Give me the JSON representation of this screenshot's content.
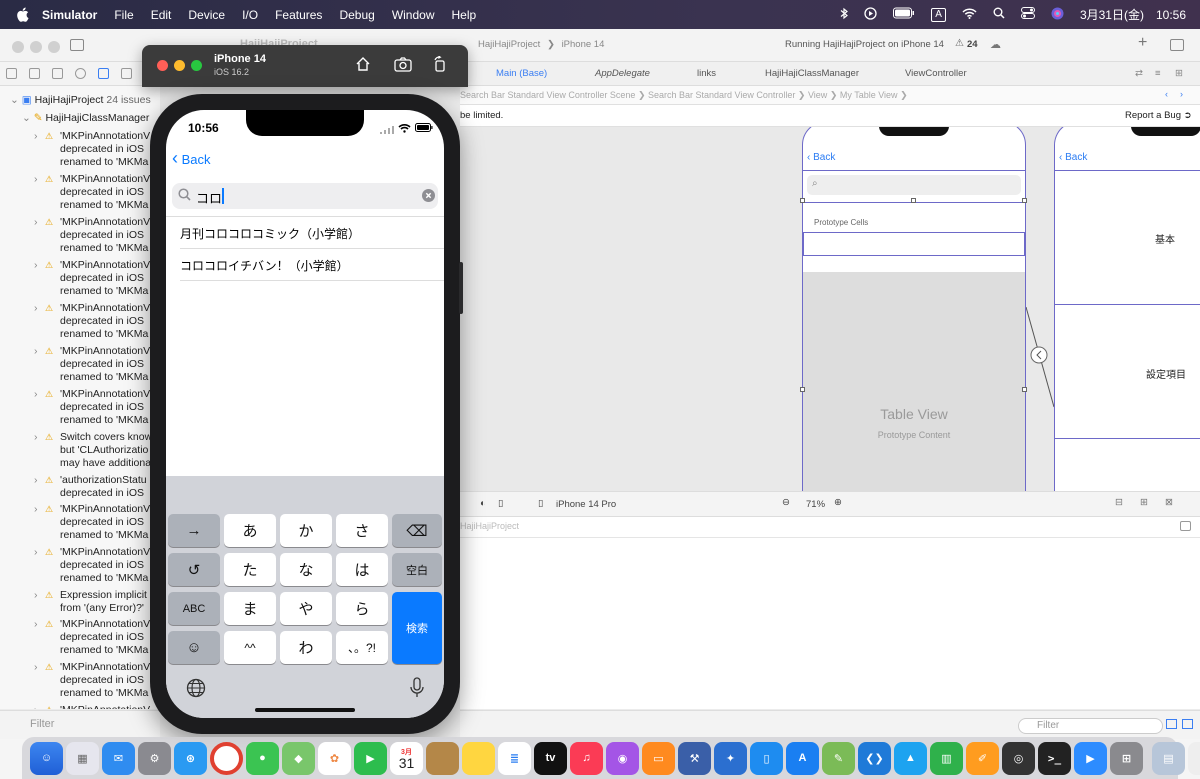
{
  "menubar": {
    "app": "Simulator",
    "items": [
      "File",
      "Edit",
      "Device",
      "I/O",
      "Features",
      "Debug",
      "Window",
      "Help"
    ],
    "input_source": "A",
    "date": "3月31日(金)",
    "time": "10:56"
  },
  "xcode": {
    "project_title": "HajiHajiProject",
    "scheme": "HajiHajiProject",
    "destination": "iPhone 14",
    "status": "Running HajiHajiProject on iPhone 14",
    "warning_count": "24",
    "tabs": [
      "Main (Base)",
      "AppDelegate",
      "links",
      "HajiHajiClassManager",
      "ViewController"
    ],
    "jumpbar": [
      "HajiHajiProject",
      "HajiHajiClassManager",
      "Main",
      "Main (Base)",
      "Search Bar Standard View Controller Scene",
      "Search Bar Standard View Controller",
      "View",
      "My Table View"
    ],
    "issue_text": "be limited.",
    "report_bug": "Report a Bug",
    "canvas_device": "iPhone 14 Pro",
    "zoom": "71%",
    "debug_label": "HajiHajiProject",
    "filter_placeholder": "Filter",
    "navigator": {
      "project": "HajiHajiProject",
      "issue_count": "24 issues",
      "group": "HajiHajiClassManager",
      "issues": [
        [
          "'MKPinAnnotationV",
          "deprecated in iOS",
          "renamed to 'MKMa"
        ],
        [
          "'MKPinAnnotationV",
          "deprecated in iOS",
          "renamed to 'MKMa"
        ],
        [
          "'MKPinAnnotationV",
          "deprecated in iOS",
          "renamed to 'MKMa"
        ],
        [
          "'MKPinAnnotationV",
          "deprecated in iOS",
          "renamed to 'MKMa"
        ],
        [
          "'MKPinAnnotationV",
          "deprecated in iOS",
          "renamed to 'MKMa"
        ],
        [
          "'MKPinAnnotationV",
          "deprecated in iOS",
          "renamed to 'MKMa"
        ],
        [
          "'MKPinAnnotationV",
          "deprecated in iOS",
          "renamed to 'MKMa"
        ],
        [
          "Switch covers know",
          "but 'CLAuthorizatio",
          "may have additiona"
        ],
        [
          "'authorizationStatu",
          "deprecated in iOS",
          ""
        ],
        [
          "'MKPinAnnotationV",
          "deprecated in iOS",
          "renamed to 'MKMa"
        ],
        [
          "'MKPinAnnotationV",
          "deprecated in iOS",
          "renamed to 'MKMa"
        ],
        [
          "Expression implicit",
          "from '(any Error)?'",
          ""
        ],
        [
          "'MKPinAnnotationV",
          "deprecated in iOS",
          "renamed to 'MKMa"
        ],
        [
          "'MKPinAnnotationV",
          "deprecated in iOS",
          "renamed to 'MKMa"
        ],
        [
          "'MKPinAnnotationV",
          "",
          ""
        ]
      ]
    },
    "storyboard": {
      "scene1_back": "Back",
      "prototype_cells": "Prototype Cells",
      "table_view": "Table View",
      "prototype_content": "Prototype Content",
      "scene2_back": "Back",
      "scene2_row1": "基本",
      "scene2_row2": "設定項目"
    }
  },
  "simulator": {
    "device": "iPhone 14",
    "os": "iOS 16.2",
    "status_time": "10:56",
    "back": "Back",
    "search_text": "コロ",
    "results": [
      "月刊コロコロコミック（小学館）",
      "コロコロイチバン！（小学館）"
    ],
    "keyboard": {
      "row1": [
        "→",
        "あ",
        "か",
        "さ",
        "⌫"
      ],
      "row2": [
        "↺",
        "た",
        "な",
        "は",
        "空白"
      ],
      "row3": [
        "ABC",
        "ま",
        "や",
        "ら"
      ],
      "row4": [
        "☺",
        "^^",
        "わ",
        "、。?!"
      ],
      "search": "検索"
    }
  },
  "dock": {
    "calendar_day": "31",
    "calendar_month": "3月"
  }
}
